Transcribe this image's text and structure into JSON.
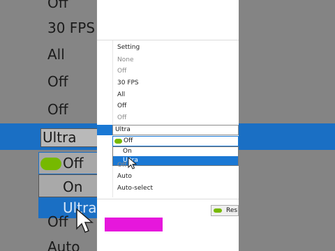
{
  "background": {
    "left_items": [
      "Off",
      "30 FPS",
      "All",
      "Off",
      "Off",
      "Ultra",
      "Off",
      "On",
      "Ultra",
      "Off",
      "Auto"
    ]
  },
  "settings": {
    "column_header": "Setting",
    "rows_above": [
      "None",
      "Off",
      "30 FPS",
      "All",
      "Off",
      "Off"
    ],
    "selected_row_value": "Ultra",
    "combo_value": "Off",
    "dropdown_options": [
      "On",
      "Ultra"
    ],
    "dropdown_selected": "Ultra",
    "rows_below": [
      "Off",
      "Auto",
      "Auto-select"
    ],
    "restore_label": "Res"
  },
  "colors": {
    "accent": "#1a78d4",
    "nvidia_green": "#76b900",
    "overlay_magenta": "#e617dc"
  },
  "icons": [
    "nvidia-icon",
    "mouse-pointer-icon"
  ]
}
